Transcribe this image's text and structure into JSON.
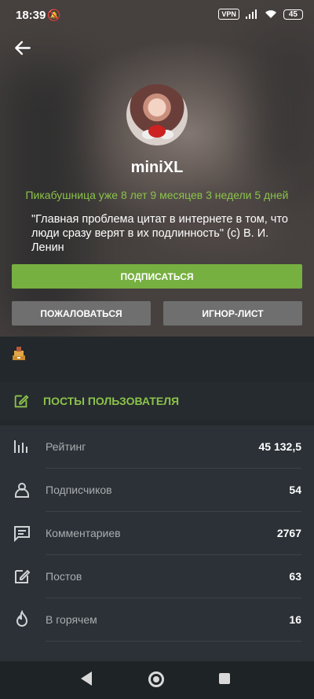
{
  "status_bar": {
    "time": "18:39",
    "vpn": "VPN",
    "battery": "45"
  },
  "profile": {
    "username": "miniXL",
    "tenure": "Пикабушница уже 8 лет 9 месяцев 3 недели 5 дней",
    "bio": "\"Главная проблема цитат в интернете в том, что люди сразу верят в их подлинность\" (с) В. И. Ленин"
  },
  "actions": {
    "subscribe": "ПОДПИСАТЬСЯ",
    "report": "ПОЖАЛОВАТЬСЯ",
    "ignore": "ИГНОР-ЛИСТ"
  },
  "posts_link": {
    "label": "ПОСТЫ ПОЛЬЗОВАТЕЛЯ"
  },
  "stats": [
    {
      "icon": "rating-icon",
      "label": "Рейтинг",
      "value": "45 132,5"
    },
    {
      "icon": "user-icon",
      "label": "Подписчиков",
      "value": "54"
    },
    {
      "icon": "comment-icon",
      "label": "Комментариев",
      "value": "2767"
    },
    {
      "icon": "edit-icon",
      "label": "Постов",
      "value": "63"
    },
    {
      "icon": "fire-icon",
      "label": "В горячем",
      "value": "16"
    }
  ],
  "colors": {
    "accent": "#8bc34a",
    "button_primary": "#76b041",
    "button_secondary": "#6f6f6f",
    "background": "#23282c"
  }
}
